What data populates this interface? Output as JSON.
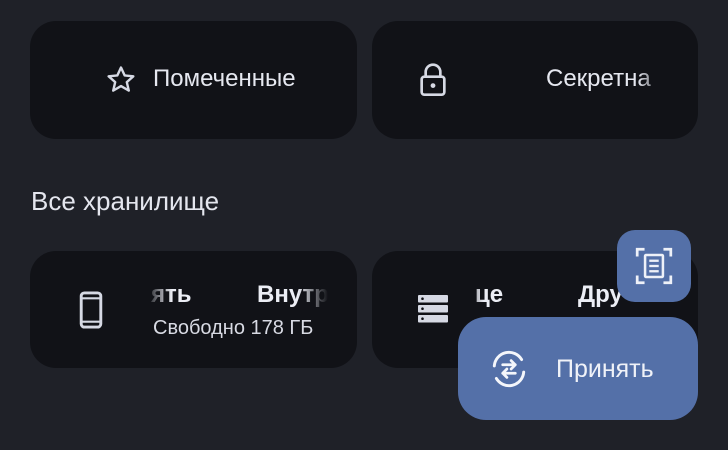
{
  "quick_access": {
    "starred": {
      "label": "Помеченные",
      "icon": "star-outline-icon"
    },
    "secret": {
      "label": "Секретна",
      "icon": "lock-icon"
    }
  },
  "storage_section": {
    "title": "Все хранилище",
    "internal": {
      "label_fragment_left": "ять",
      "label_fragment_right": "Внутр",
      "free_space": "Свободно 178 ГБ",
      "icon": "phone-icon"
    },
    "other": {
      "label_fragment_left": "це",
      "label_fragment_right": "Дру",
      "icon": "storage-stack-icon"
    }
  },
  "fab": {
    "scan_icon": "document-scan-icon",
    "accept_label": "Принять",
    "accept_icon": "sync-exchange-icon"
  },
  "colors": {
    "background": "#1f2128",
    "card": "#111217",
    "accent": "#5470a8"
  }
}
